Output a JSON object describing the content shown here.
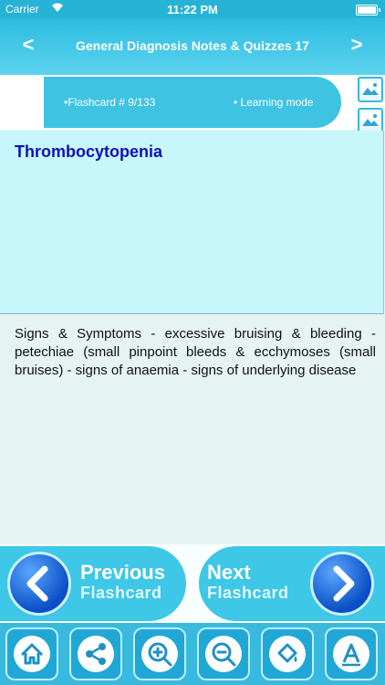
{
  "status_bar": {
    "carrier": "Carrier",
    "time": "11:22 PM"
  },
  "nav": {
    "title": "General Diagnosis Notes & Quizzes 17",
    "back_symbol": "<",
    "forward_symbol": ">"
  },
  "flashcard_header": {
    "counter": "•Flashcard #  9/133",
    "mode": "• Learning mode"
  },
  "side_icons": [
    "image-icon",
    "image-icon"
  ],
  "card": {
    "question": "Thrombocytopenia",
    "answer": "Signs & Symptoms - excessive bruising & bleeding - petechiae (small pinpoint bleeds & ecchymoses (small bruises) - signs of anaemia - signs of underlying disease"
  },
  "buttons": {
    "previous": {
      "big": "Previous",
      "small": "Flashcard"
    },
    "next": {
      "big": "Next",
      "small": "Flashcard"
    }
  },
  "toolbar": [
    "home-icon",
    "share-icon",
    "zoom-in-icon",
    "zoom-out-icon",
    "paint-bucket-icon",
    "font-icon"
  ],
  "colors": {
    "accent": "#3ec3e3",
    "question_text": "#1010b8",
    "button_circle": "#0a4fc5"
  }
}
